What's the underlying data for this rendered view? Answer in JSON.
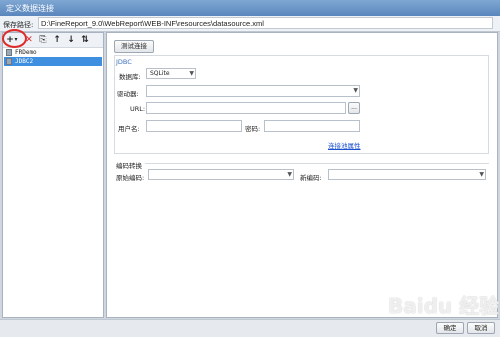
{
  "window": {
    "title": "定义数据连接"
  },
  "path": {
    "label": "保存路径:",
    "value": "D:\\FineReport_9.0\\WebReport\\WEB-INF\\resources\\datasource.xml"
  },
  "toolbar": {
    "add": "+",
    "add_caret": "▾",
    "delete": "✕",
    "copy": "⎘",
    "up": "↑",
    "down": "↓",
    "sort": "⇅"
  },
  "tree": {
    "items": [
      {
        "label": "FRDemo"
      },
      {
        "label": "JDBC2"
      }
    ]
  },
  "test_button": "测试连接",
  "jdbc": {
    "group_label": "JDBC",
    "db_label": "数据库:",
    "db_value": "SQLite",
    "driver_label": "驱动器:",
    "driver_value": "",
    "url_label": "URL:",
    "url_value": "",
    "url_browse": "...",
    "user_label": "用户名:",
    "user_value": "",
    "pwd_label": "密码:",
    "pwd_value": "",
    "pool_link": "连接池属性"
  },
  "encoding": {
    "group_label": "编码转换",
    "orig_label": "原始编码:",
    "orig_value": "",
    "new_label": "新编码:",
    "new_value": ""
  },
  "buttons": {
    "ok": "确定",
    "cancel": "取消"
  },
  "watermark": "Baidu 经验",
  "colors": {
    "selection": "#3f8fe0",
    "link": "#1a4fd0",
    "highlight_circle": "#e02a2a",
    "delete_icon": "#d42c2c"
  }
}
